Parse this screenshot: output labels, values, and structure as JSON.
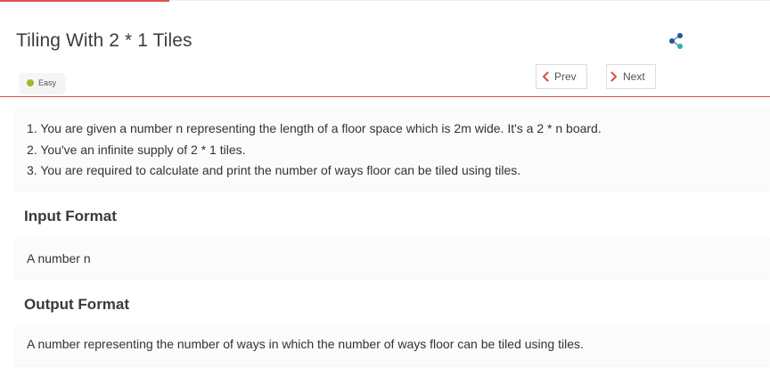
{
  "problem": {
    "title": "Tiling With 2 * 1 Tiles",
    "difficulty": "Easy",
    "difficulty_color": "#a6b71e"
  },
  "nav": {
    "prev_label": "Prev",
    "next_label": "Next",
    "arrow_color": "#d9534f"
  },
  "share": {
    "icon": "share-icon",
    "colors": [
      "#1e5a9e",
      "#2bb3a0",
      "#1e5a9e"
    ]
  },
  "description": {
    "lines": [
      "1. You are given a number n representing the length of a floor space which is 2m wide. It's a 2 * n board.",
      "2. You've an infinite supply of 2 * 1 tiles.",
      "3. You are required to calculate and print the number of ways floor can be tiled using tiles."
    ]
  },
  "input_format": {
    "heading": "Input Format",
    "text": "A number n"
  },
  "output_format": {
    "heading": "Output Format",
    "text": "A number representing the number of ways in which the number of ways floor can be tiled using tiles."
  }
}
